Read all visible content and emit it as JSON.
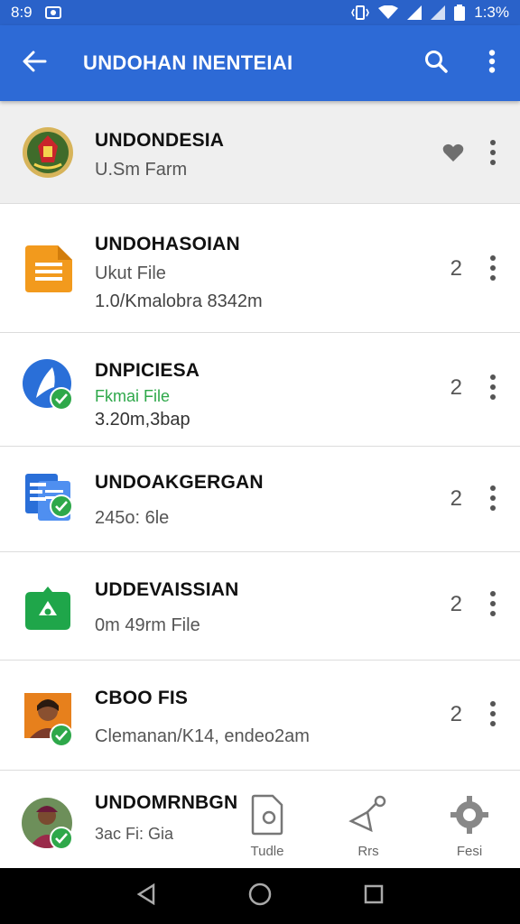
{
  "status_bar": {
    "time_left": "8:9",
    "time_right": "1:3%"
  },
  "app_bar": {
    "title": "UNDOHAN INENTEIAI",
    "back_icon": "arrow-left-icon",
    "search_icon": "search-icon",
    "more_icon": "more-vert-icon",
    "color": "#2d6ad6"
  },
  "items": [
    {
      "name": "UNDONDESIA",
      "subtitle": "U.Sm Farm",
      "detail": "",
      "count": "",
      "trailing_icon": "heart-icon",
      "avatar": "emblem"
    },
    {
      "name": "UNDOHASOIAN",
      "subtitle": "Ukut File",
      "detail": "1.0/Kmalobra 8342m",
      "count": "2",
      "avatar": "document-icon"
    },
    {
      "name": "DNPICIESA",
      "subtitle": "Fkmai File",
      "detail": "3.20m,3bap",
      "count": "2",
      "avatar": "sail-logo"
    },
    {
      "name": "UNDOAKGERGAN",
      "subtitle": "245o: 6le",
      "detail": "",
      "count": "2",
      "avatar": "forms-icon"
    },
    {
      "name": "UDDEVAISSIAN",
      "subtitle": "0m 49rm  File",
      "detail": "",
      "count": "2",
      "avatar": "money-icon"
    },
    {
      "name": "CBOO FIS",
      "subtitle": "Clemanan/K14, endeo2am",
      "detail": "",
      "count": "2",
      "avatar": "person-photo"
    },
    {
      "name": "UNDOMRNBGN",
      "subtitle": "3ac Fi: Gia",
      "detail": "",
      "count": "",
      "avatar": "person-photo-2"
    }
  ],
  "bottom_tabs": [
    {
      "label": "Tudle",
      "icon": "file-icon"
    },
    {
      "label": "Rrs",
      "icon": "magic-wand-icon"
    },
    {
      "label": "Fesi",
      "icon": "gear-icon"
    }
  ],
  "colors": {
    "accent": "#2d6ad6",
    "check_green": "#2ea84a",
    "file_orange": "#f29a1d",
    "docs_blue": "#2a6fd8",
    "money_green": "#1fa64a"
  }
}
